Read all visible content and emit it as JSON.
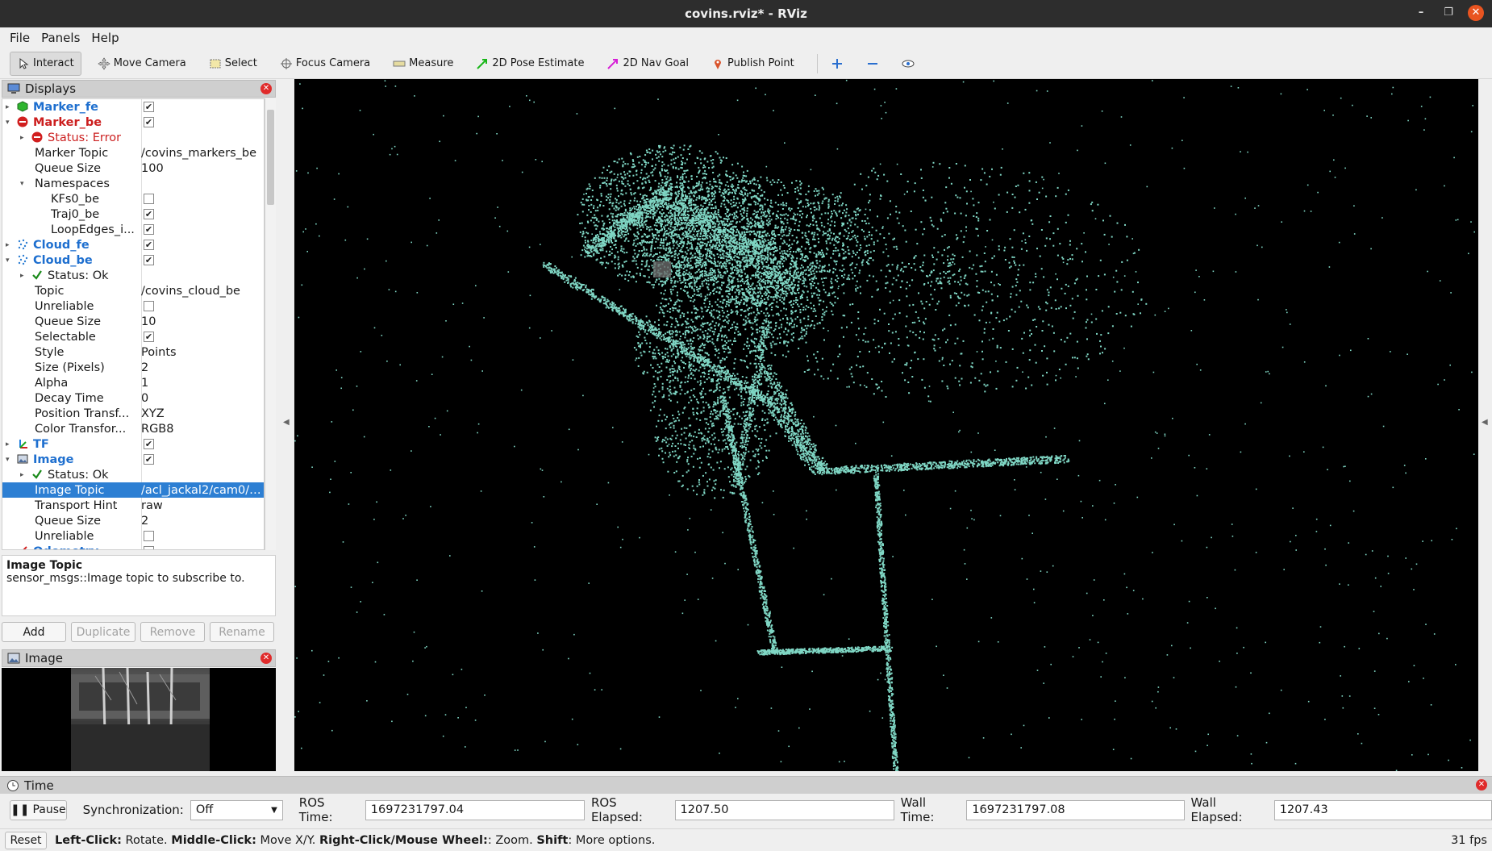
{
  "window": {
    "title": "covins.rviz* - RViz"
  },
  "menu": [
    "File",
    "Panels",
    "Help"
  ],
  "toolbar": [
    {
      "label": "Interact",
      "icon": "cursor-icon",
      "active": true
    },
    {
      "label": "Move Camera",
      "icon": "move-camera-icon"
    },
    {
      "label": "Select",
      "icon": "select-box-icon"
    },
    {
      "label": "Focus Camera",
      "icon": "crosshair-icon"
    },
    {
      "label": "Measure",
      "icon": "ruler-icon"
    },
    {
      "label": "2D Pose Estimate",
      "icon": "green-arrow-icon"
    },
    {
      "label": "2D Nav Goal",
      "icon": "magenta-arrow-icon"
    },
    {
      "label": "Publish Point",
      "icon": "map-pin-icon"
    }
  ],
  "displays_panel": {
    "title": "Displays",
    "rows": [
      {
        "indent": 0,
        "arrow": "right",
        "icon": "green-cube-icon",
        "label": "Marker_fe",
        "style": "blue",
        "check": true
      },
      {
        "indent": 0,
        "arrow": "down",
        "icon": "error-icon",
        "label": "Marker_be",
        "style": "red",
        "check": true
      },
      {
        "indent": 1,
        "arrow": "right",
        "icon": "error-icon",
        "label": "Status: Error",
        "style": "err"
      },
      {
        "indent": 1,
        "label": "Marker Topic",
        "value": "/covins_markers_be"
      },
      {
        "indent": 1,
        "label": "Queue Size",
        "value": "100"
      },
      {
        "indent": 1,
        "arrow": "down",
        "label": "Namespaces"
      },
      {
        "indent": 2,
        "label": "KFs0_be",
        "check": false
      },
      {
        "indent": 2,
        "label": "Traj0_be",
        "check": true
      },
      {
        "indent": 2,
        "label": "LoopEdges_i...",
        "check": true
      },
      {
        "indent": 0,
        "arrow": "right",
        "icon": "pointcloud-icon",
        "label": "Cloud_fe",
        "style": "blue",
        "check": true
      },
      {
        "indent": 0,
        "arrow": "down",
        "icon": "pointcloud-icon",
        "label": "Cloud_be",
        "style": "blue",
        "check": true
      },
      {
        "indent": 1,
        "arrow": "right",
        "icon": "checkmark-icon",
        "label": "Status: Ok"
      },
      {
        "indent": 1,
        "label": "Topic",
        "value": "/covins_cloud_be"
      },
      {
        "indent": 1,
        "label": "Unreliable",
        "check": false
      },
      {
        "indent": 1,
        "label": "Queue Size",
        "value": "10"
      },
      {
        "indent": 1,
        "label": "Selectable",
        "check": true
      },
      {
        "indent": 1,
        "label": "Style",
        "value": "Points"
      },
      {
        "indent": 1,
        "label": "Size (Pixels)",
        "value": "2"
      },
      {
        "indent": 1,
        "label": "Alpha",
        "value": "1"
      },
      {
        "indent": 1,
        "label": "Decay Time",
        "value": "0"
      },
      {
        "indent": 1,
        "label": "Position Transf...",
        "value": "XYZ"
      },
      {
        "indent": 1,
        "label": "Color Transfor...",
        "value": "RGB8"
      },
      {
        "indent": 0,
        "arrow": "right",
        "icon": "tf-axes-icon",
        "label": "TF",
        "style": "blue",
        "check": true
      },
      {
        "indent": 0,
        "arrow": "down",
        "icon": "image-icon",
        "label": "Image",
        "style": "blue",
        "check": true
      },
      {
        "indent": 1,
        "arrow": "right",
        "icon": "checkmark-icon",
        "label": "Status: Ok"
      },
      {
        "indent": 1,
        "label": "Image Topic",
        "value": "/acl_jackal2/cam0/i...",
        "selected": true
      },
      {
        "indent": 1,
        "label": "Transport Hint",
        "value": "raw"
      },
      {
        "indent": 1,
        "label": "Queue Size",
        "value": "2"
      },
      {
        "indent": 1,
        "label": "Unreliable",
        "check": false
      },
      {
        "indent": 0,
        "arrow": "right",
        "icon": "odometry-icon",
        "label": "Odometry",
        "style": "blue",
        "check": false
      }
    ]
  },
  "description": {
    "title": "Image Topic",
    "text": "sensor_msgs::Image topic to subscribe to."
  },
  "buttons": {
    "add": "Add",
    "duplicate": "Duplicate",
    "remove": "Remove",
    "rename": "Rename"
  },
  "image_panel": {
    "title": "Image"
  },
  "time_panel": {
    "title": "Time",
    "pause": "Pause",
    "sync_label": "Synchronization:",
    "sync_value": "Off",
    "ros_time_label": "ROS Time:",
    "ros_time": "1697231797.04",
    "ros_elapsed_label": "ROS Elapsed:",
    "ros_elapsed": "1207.50",
    "wall_time_label": "Wall Time:",
    "wall_time": "1697231797.08",
    "wall_elapsed_label": "Wall Elapsed:",
    "wall_elapsed": "1207.43"
  },
  "statusbar": {
    "reset": "Reset",
    "hint_left_b": "Left-Click:",
    "hint_left": " Rotate. ",
    "hint_mid_b": "Middle-Click:",
    "hint_mid": " Move X/Y. ",
    "hint_right_b": "Right-Click/Mouse Wheel:",
    "hint_right": ": Zoom. ",
    "hint_shift_b": "Shift",
    "hint_shift": ": More options.",
    "fps": "31 fps"
  },
  "colors": {
    "cloud": "#7fd6c4",
    "selection": "#2d7fd3",
    "error": "#cc1f1f",
    "display_blue": "#1e6fcf"
  }
}
